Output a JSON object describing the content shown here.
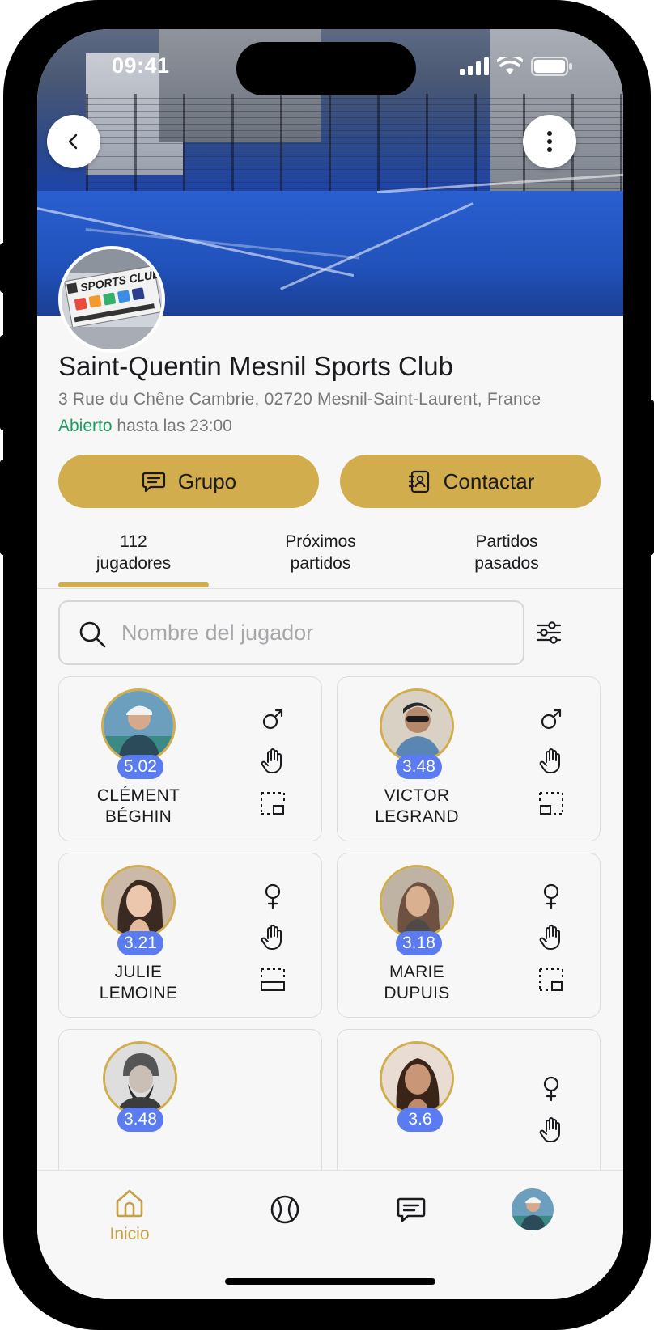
{
  "status_bar": {
    "time": "09:41"
  },
  "club": {
    "name": "Saint-Quentin Mesnil Sports Club",
    "address": "3 Rue du Chêne Cambrie, 02720 Mesnil-Saint-Laurent, France",
    "open_status": "Abierto",
    "hours": "hasta las 23:00",
    "logo_text": "SPORTS CLUB"
  },
  "actions": {
    "group_label": "Grupo",
    "contact_label": "Contactar"
  },
  "tabs": [
    {
      "line1": "112",
      "line2": "jugadores",
      "active": true
    },
    {
      "line1": "Próximos",
      "line2": "partidos",
      "active": false
    },
    {
      "line1": "Partidos",
      "line2": "pasados",
      "active": false
    }
  ],
  "search": {
    "placeholder": "Nombre del jugador",
    "value": ""
  },
  "players": [
    {
      "first": "CLÉMENT",
      "last": "BÉGHIN",
      "rating": "5.02",
      "gender": "male-icon",
      "hand": "hand-icon",
      "position": "court-right-icon"
    },
    {
      "first": "VICTOR",
      "last": "LEGRAND",
      "rating": "3.48",
      "gender": "male-icon",
      "hand": "hand-icon",
      "position": "court-left-icon"
    },
    {
      "first": "JULIE",
      "last": "LEMOINE",
      "rating": "3.21",
      "gender": "female-icon",
      "hand": "hand-icon",
      "position": "court-both-icon"
    },
    {
      "first": "MARIE",
      "last": "DUPUIS",
      "rating": "3.18",
      "gender": "female-icon",
      "hand": "hand-icon",
      "position": "court-right-icon"
    },
    {
      "first": "",
      "last": "",
      "rating": "3.48",
      "gender": "",
      "hand": "",
      "position": ""
    },
    {
      "first": "",
      "last": "",
      "rating": "3.6",
      "gender": "female-icon",
      "hand": "hand-icon",
      "position": ""
    }
  ],
  "nav": {
    "home_label": "Inicio"
  },
  "colors": {
    "accent": "#d1ad4d",
    "rating_badge": "#5b7cf0",
    "open_green": "#1c9d62"
  }
}
